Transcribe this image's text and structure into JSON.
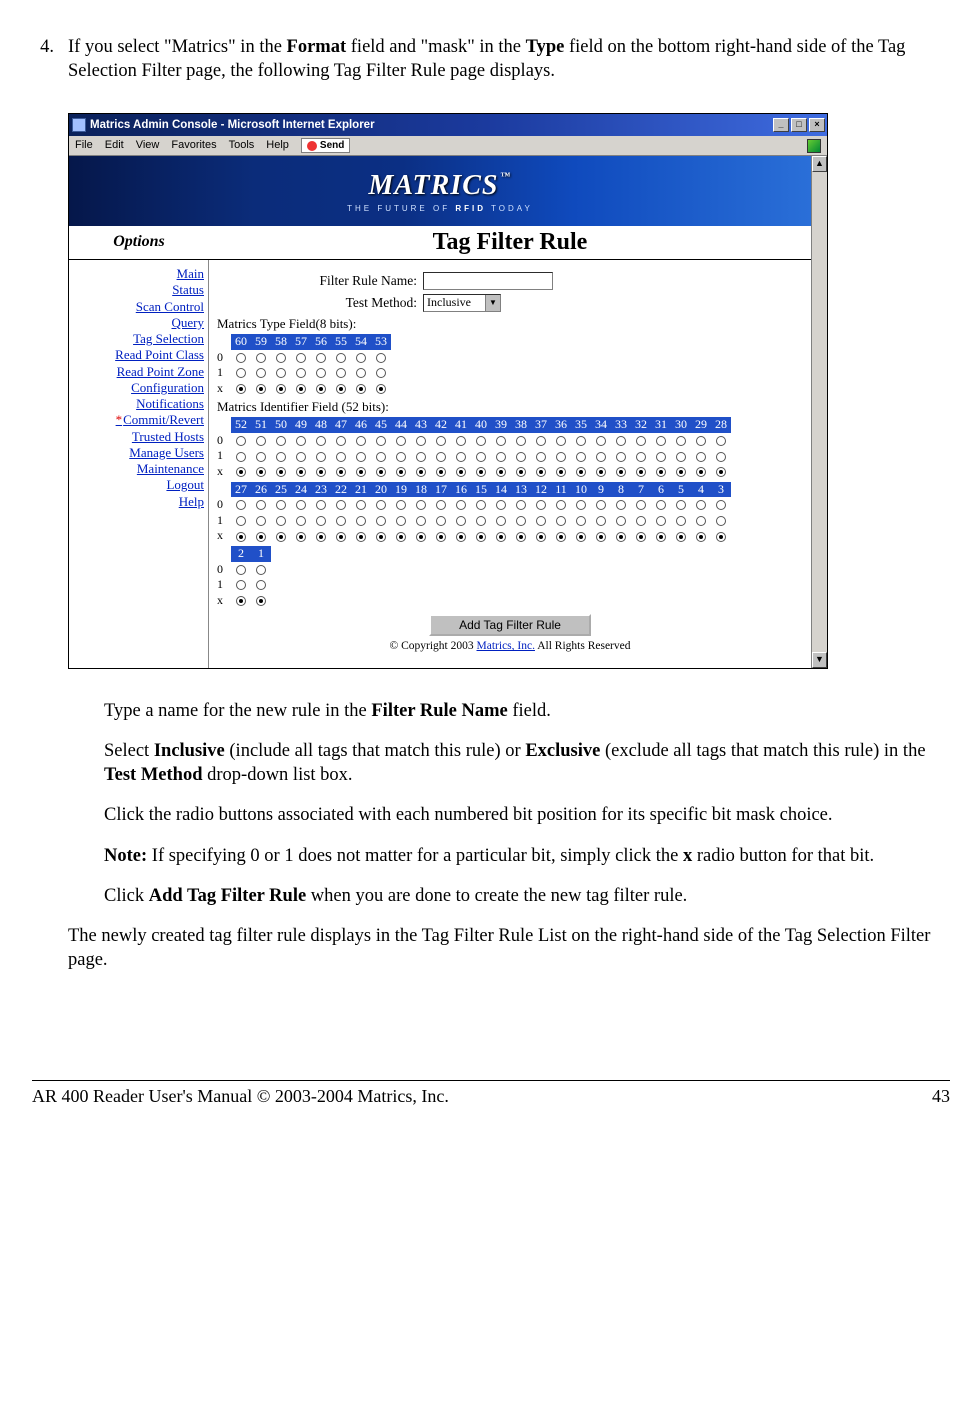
{
  "step": {
    "num": "4.",
    "text_a": "If you select \"Matrics\" in the ",
    "bold_a": "Format",
    "text_b": " field and \"mask\" in the ",
    "bold_b": "Type",
    "text_c": " field on the bottom right-hand side of the Tag Selection Filter page, the following Tag Filter Rule page displays."
  },
  "window": {
    "title": "Matrics Admin Console - Microsoft Internet Explorer",
    "menus": [
      "File",
      "Edit",
      "View",
      "Favorites",
      "Tools",
      "Help"
    ],
    "send_label": "Send",
    "min": "_",
    "max": "□",
    "close": "×",
    "scroll_up": "▲",
    "scroll_dn": "▼",
    "brand": "MATRICS",
    "brand_tm": "™",
    "tagline_a": "THE FUTURE OF ",
    "tagline_b": "RFID",
    "tagline_c": " TODAY",
    "options_label": "Options",
    "page_title": "Tag Filter Rule"
  },
  "sidebar": {
    "links": [
      "Main",
      "Status",
      "Scan Control",
      "Query",
      "Tag Selection",
      "Read Point Class",
      "Read Point Zone",
      "Configuration",
      "Notifications",
      "*Commit/Revert",
      "Trusted Hosts",
      "Manage Users",
      "Maintenance",
      "Logout",
      "Help"
    ]
  },
  "form": {
    "name_label": "Filter Rule Name:",
    "method_label": "Test Method:",
    "method_value": "Inclusive",
    "dd": "▼",
    "type_label": "Matrics Type Field(8 bits):",
    "type_bits": [
      "60",
      "59",
      "58",
      "57",
      "56",
      "55",
      "54",
      "53"
    ],
    "id_label": "Matrics Identifier Field (52 bits):",
    "id_bits_1": [
      "52",
      "51",
      "50",
      "49",
      "48",
      "47",
      "46",
      "45",
      "44",
      "43",
      "42",
      "41",
      "40",
      "39",
      "38",
      "37",
      "36",
      "35",
      "34",
      "33",
      "32",
      "31",
      "30",
      "29",
      "28"
    ],
    "id_bits_2": [
      "27",
      "26",
      "25",
      "24",
      "23",
      "22",
      "21",
      "20",
      "19",
      "18",
      "17",
      "16",
      "15",
      "14",
      "13",
      "12",
      "11",
      "10",
      "9",
      "8",
      "7",
      "6",
      "5",
      "4",
      "3"
    ],
    "id_bits_3": [
      "2",
      "1"
    ],
    "row_labels": [
      "0",
      "1",
      "x"
    ],
    "add_btn": "Add Tag Filter Rule",
    "copyright_a": "© Copyright 2003 ",
    "copyright_link": "Matrics, Inc.",
    "copyright_b": "  All Rights Reserved"
  },
  "sub": {
    "a1": "Type a name for the new rule in the ",
    "a2": "Filter Rule Name",
    "a3": " field.",
    "b1": "Select ",
    "b2": "Inclusive",
    "b3": " (include all tags that match this rule) or ",
    "b4": "Exclusive",
    "b5": " (exclude all tags that match this rule) in the ",
    "b6": "Test Method",
    "b7": " drop-down list box.",
    "c1": "Click the radio buttons associated with each numbered bit position for its specific bit mask choice.",
    "n1": "Note:",
    "n2": " If specifying 0 or 1 does not matter for a particular bit, simply click the ",
    "n3": "x",
    "n4": " radio button for that bit.",
    "d1": "Click ",
    "d2": "Add Tag Filter Rule",
    "d3": " when you are done to create the new tag filter rule."
  },
  "closing": "The newly created tag filter rule displays in the Tag Filter Rule List on the right-hand side of the Tag Selection Filter page.",
  "footer": {
    "left": "AR 400 Reader User's Manual © 2003-2004 Matrics, Inc.",
    "right": "43"
  }
}
